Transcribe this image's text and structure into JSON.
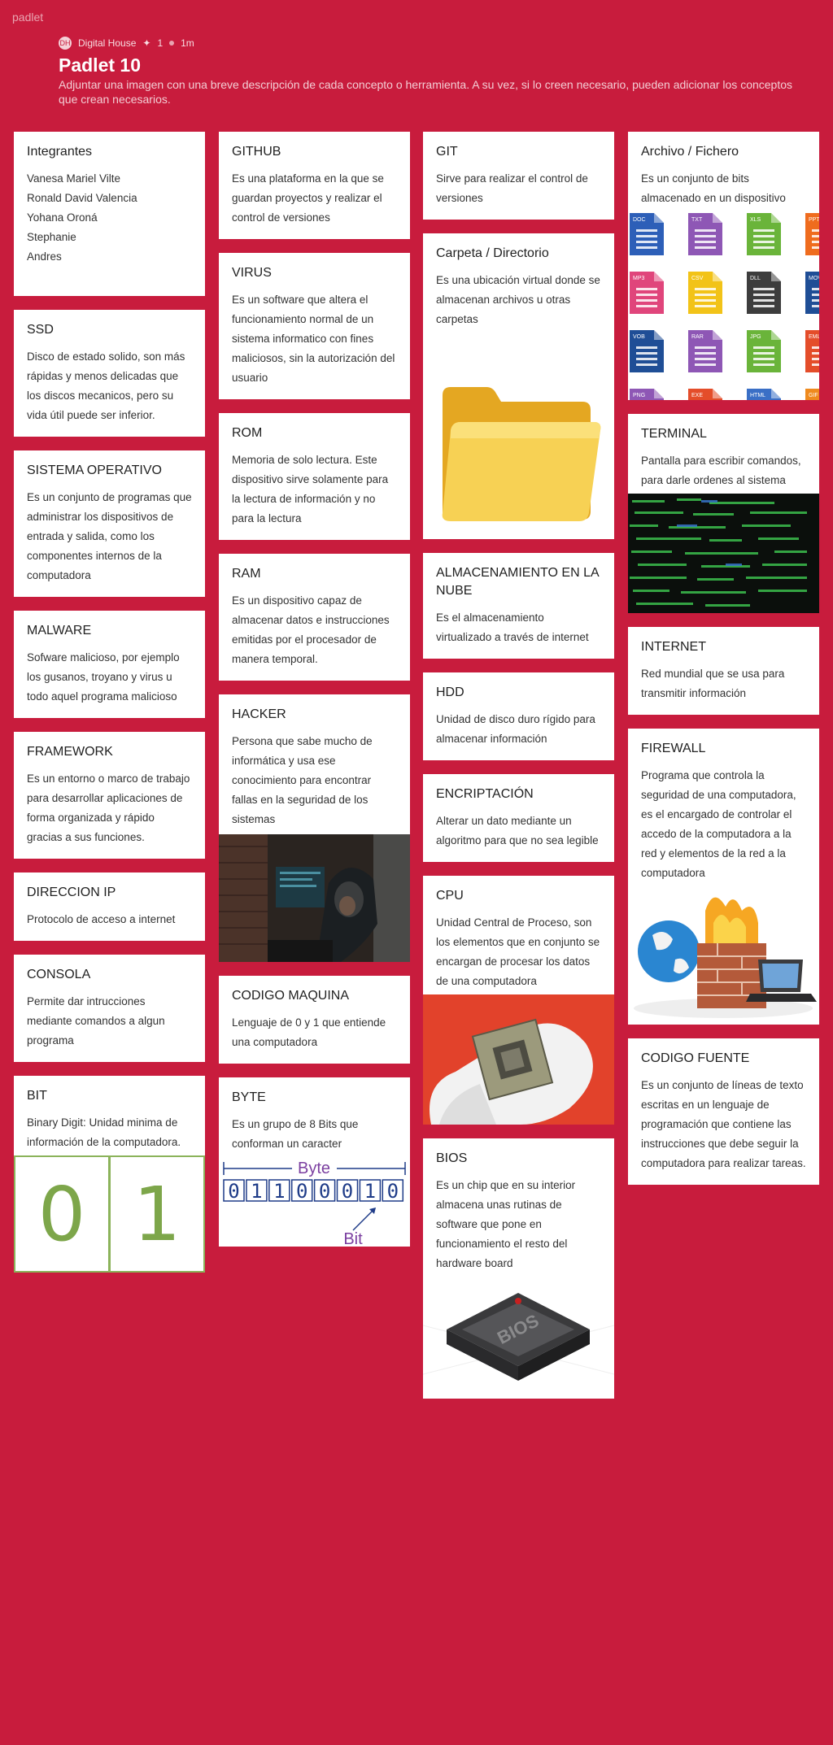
{
  "brand": "padlet",
  "header": {
    "author": "Digital House",
    "likes": "1",
    "time": "1m",
    "title": "Padlet 10",
    "description": "Adjuntar una imagen con una breve descripción de cada concepto o herramienta. A su vez, si lo creen necesario, pueden adicionar los conceptos que crean necesarios."
  },
  "posts": {
    "integrantes": {
      "title": "Integrantes",
      "lines": [
        "Vanesa Mariel Vilte",
        "Ronald David Valencia",
        "Yohana Oroná",
        "Stephanie",
        "Andres"
      ]
    },
    "ssd": {
      "title": "SSD",
      "body": "Disco de estado solido, son más rápidas y menos delicadas que los discos mecanicos, pero su vida útil puede ser inferior."
    },
    "so": {
      "title": "SISTEMA OPERATIVO",
      "body": "Es un conjunto de programas que administrar los dispositivos de entrada y salida, como los componentes internos de la computadora"
    },
    "malware": {
      "title": "MALWARE",
      "body": "Sofware malicioso, por ejemplo los gusanos, troyano y virus u todo aquel programa malicioso"
    },
    "framework": {
      "title": "FRAMEWORK",
      "body": "Es un entorno o marco de trabajo para desarrollar aplicaciones de forma organizada y rápido gracias a sus funciones."
    },
    "ip": {
      "title": "DIRECCION IP",
      "body": "Protocolo de acceso a internet"
    },
    "consola": {
      "title": "CONSOLA",
      "body": "Permite dar intrucciones mediante comandos a algun programa"
    },
    "bit": {
      "title": "BIT",
      "body": "Binary Digit: Unidad minima de información de la computadora.",
      "digits": [
        "0",
        "1"
      ]
    },
    "github": {
      "title": "GITHUB",
      "body": "Es una plataforma en la que se guardan proyectos y realizar el control de versiones"
    },
    "virus": {
      "title": "VIRUS",
      "body": "Es un software que altera el funcionamiento normal de un sistema informatico con fines maliciosos, sin la autorización del usuario"
    },
    "rom": {
      "title": "ROM",
      "body": "Memoria de solo lectura. Este dispositivo sirve solamente para la lectura de información y no para la lectura"
    },
    "ram": {
      "title": "RAM",
      "body": "Es un dispositivo capaz de almacenar  datos e instrucciones emitidas por el procesador de manera temporal."
    },
    "hacker": {
      "title": "HACKER",
      "body": "Persona que sabe mucho de informática y usa ese conocimiento para encontrar fallas en la seguridad de los sistemas"
    },
    "codigo_maquina": {
      "title": "CODIGO MAQUINA",
      "body": "Lenguaje de 0 y 1 que entiende una computadora"
    },
    "byte": {
      "title": "BYTE",
      "body": "Es un grupo de 8 Bits que conforman un caracter",
      "diagram_top": "Byte",
      "diagram_bottom": "Bit",
      "bits": [
        "0",
        "1",
        "1",
        "0",
        "0",
        "0",
        "1",
        "0"
      ]
    },
    "git": {
      "title": "GIT",
      "body": "Sirve para realizar el control de versiones"
    },
    "carpeta": {
      "title": "Carpeta / Directorio",
      "body": "Es una ubicación virtual donde se almacenan archivos u otras carpetas"
    },
    "nube": {
      "title": "ALMACENAMIENTO EN LA NUBE",
      "body": "Es el almacenamiento virtualizado a través de internet"
    },
    "hdd": {
      "title": "HDD",
      "body": "Unidad de disco duro rígido para almacenar información"
    },
    "encriptacion": {
      "title": "ENCRIPTACIÓN",
      "body": "Alterar un dato mediante un algoritmo para que no sea legible"
    },
    "cpu": {
      "title": "CPU",
      "body": "Unidad Central de Proceso, son los elementos que en conjunto se encargan de procesar los datos de una computadora"
    },
    "bios": {
      "title": "BIOS",
      "body": "Es un chip que en su interior almacena unas rutinas de software que pone en funcionamiento el resto del hardware board",
      "chip_label": "BIOS"
    },
    "archivo": {
      "title": "Archivo / Fichero",
      "body": "Es un conjunto de bits almacenado en un dispositivo",
      "file_types": [
        "DOC",
        "TXT",
        "XLS",
        "PPT",
        "MP3",
        "CSV",
        "DLL",
        "MOV",
        "VOB",
        "RAR",
        "JPG",
        "EML",
        "PNG",
        "EXE",
        "HTML",
        "GIF"
      ]
    },
    "terminal": {
      "title": "TERMINAL",
      "body": "Pantalla para escribir comandos, para darle ordenes al sistema"
    },
    "internet": {
      "title": "INTERNET",
      "body": "Red mundial que se usa para transmitir información"
    },
    "firewall": {
      "title": "FIREWALL",
      "body": "Programa que controla la seguridad de una computadora, es el encargado de controlar el accedo de la computadora a la red y elementos de la red a la computadora"
    },
    "codigo_fuente": {
      "title": "CODIGO FUENTE",
      "body": "Es un conjunto de líneas de texto escritas en un lenguaje de programación  que contiene las instrucciones que debe seguir la computadora  para realizar tareas."
    }
  }
}
